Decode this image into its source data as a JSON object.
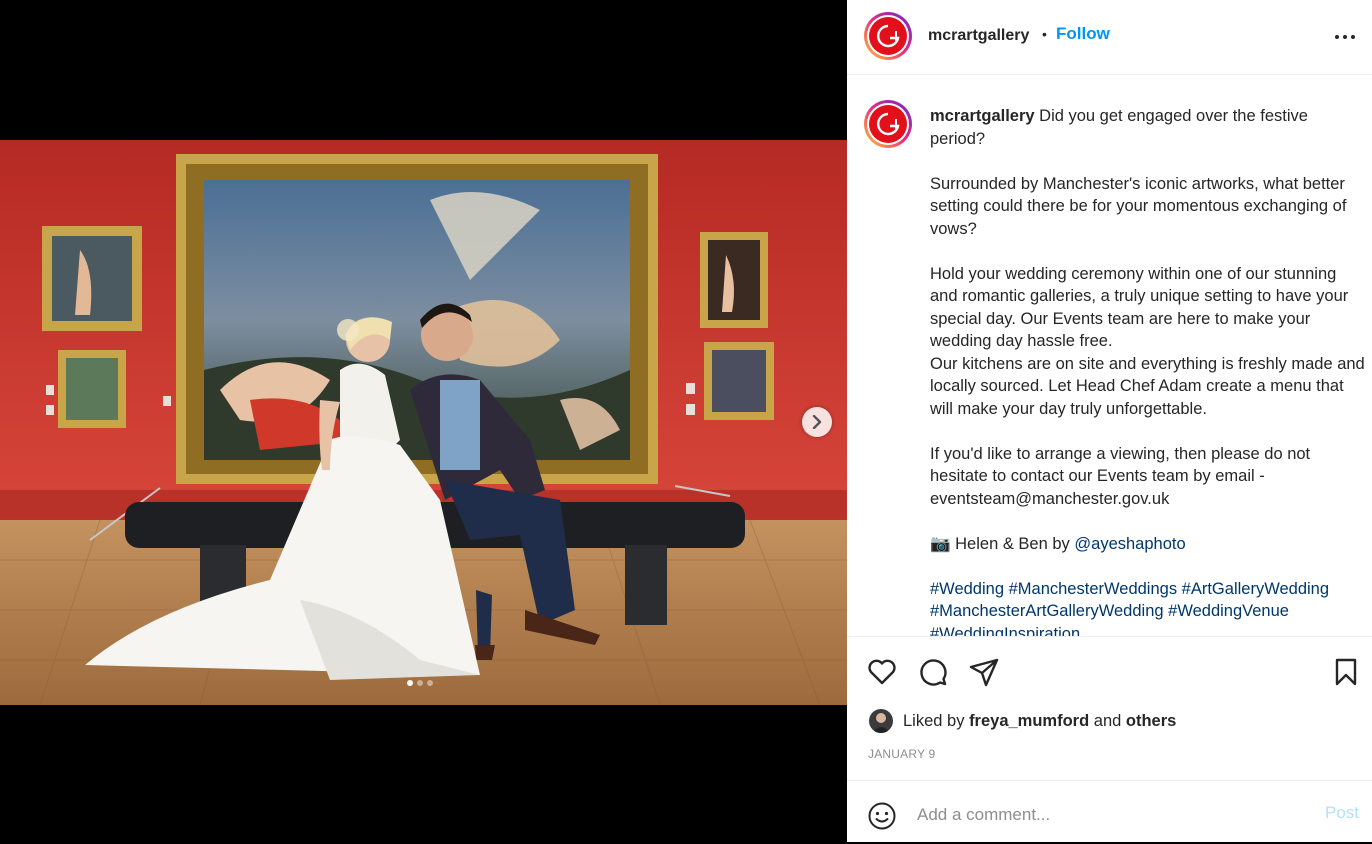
{
  "post": {
    "account": {
      "username": "mcrartgallery",
      "follow_label": "Follow",
      "separator": "•"
    },
    "media": {
      "carousel_count": 3,
      "active_index": 0,
      "colors": {
        "wall": "#c8362e",
        "floor": "#b9875a",
        "frame": "#c9a54a"
      }
    },
    "caption": {
      "username": "mcrartgallery",
      "line1": "Did you get engaged over the festive period?",
      "para2": "Surrounded by Manchester's iconic artworks, what better setting could there be for your momentous exchanging of vows?",
      "para3a": "Hold your wedding ceremony within one of our stunning and romantic galleries, a truly unique setting to have your special day. Our Events team are here to make your wedding day hassle free.",
      "para3b": "Our kitchens are on site and everything is freshly made and locally sourced. Let Head Chef Adam create a menu that will make your day truly unforgettable.",
      "para4": "If you'd like to arrange a viewing, then please do not hesitate to contact our Events team by email - eventsteam@manchester.gov.uk",
      "credit_emoji": "📷",
      "credit_text": "Helen & Ben by",
      "credit_handle": "@ayeshaphoto",
      "hashtags": [
        "#Wedding",
        "#ManchesterWeddings",
        "#ArtGalleryWedding",
        "#ManchesterArtGalleryWedding",
        "#WeddingVenue",
        "#WeddingInspiration"
      ]
    },
    "likes": {
      "prefix": "Liked by",
      "user": "freya_mumford",
      "conjunction": "and",
      "others": "others"
    },
    "date": "JANUARY 9",
    "comment": {
      "placeholder": "Add a comment...",
      "post_label": "Post"
    },
    "icons": {
      "like": "heart-icon",
      "comment": "comment-icon",
      "share": "paper-plane-icon",
      "save": "bookmark-icon",
      "emoji": "smiley-icon",
      "more": "more-dots-icon",
      "next": "chevron-right-icon"
    }
  }
}
